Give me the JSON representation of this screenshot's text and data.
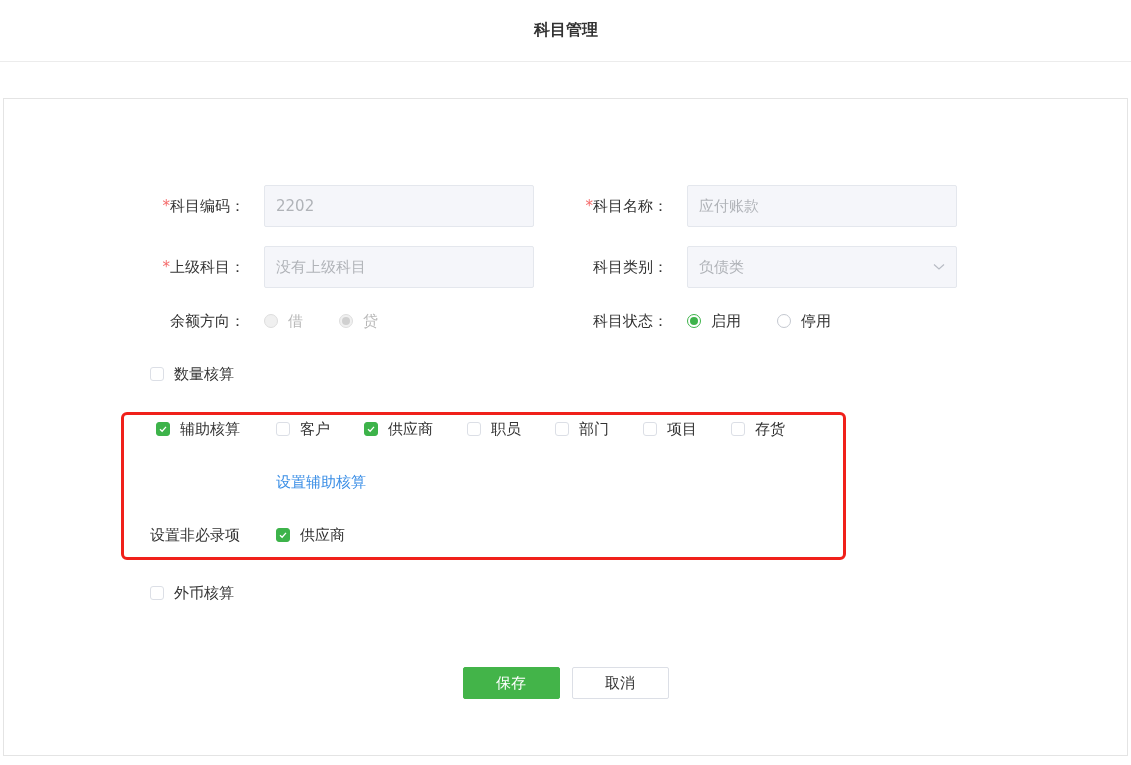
{
  "header": {
    "title": "科目管理"
  },
  "fields": [
    {
      "label": "科目编码：",
      "required_mark": "*",
      "kind": "input",
      "value": "2202"
    },
    {
      "label": "科目名称：",
      "required_mark": "*",
      "kind": "input",
      "value": "应付账款"
    },
    {
      "label": "上级科目：",
      "required_mark": "*",
      "kind": "input",
      "placeholder": "没有上级科目"
    },
    {
      "label": "科目类别：",
      "kind": "select",
      "value": "负债类"
    },
    {
      "label": "余额方向：",
      "kind": "radio",
      "disabled": true,
      "options": [
        {
          "label": "借",
          "selected": false
        },
        {
          "label": "贷",
          "selected": true
        }
      ]
    },
    {
      "label": "科目状态：",
      "kind": "radio",
      "disabled": false,
      "options": [
        {
          "label": "启用",
          "selected": true
        },
        {
          "label": "停用",
          "selected": false
        }
      ]
    }
  ],
  "quantity": {
    "label": "数量核算",
    "checked": false
  },
  "auxiliary": {
    "highlighted": true,
    "label": "辅助核算",
    "checked": true,
    "options": [
      {
        "label": "客户",
        "checked": false
      },
      {
        "label": "供应商",
        "checked": true
      },
      {
        "label": "职员",
        "checked": false
      },
      {
        "label": "部门",
        "checked": false
      },
      {
        "label": "项目",
        "checked": false
      },
      {
        "label": "存货",
        "checked": false
      }
    ],
    "link": "设置辅助核算",
    "optional_label": "设置非必录项",
    "optional_items": [
      {
        "label": "供应商",
        "checked": true
      }
    ]
  },
  "foreign_currency": {
    "label": "外币核算",
    "checked": false
  },
  "buttons": [
    {
      "label": "保存",
      "kind": "primary"
    },
    {
      "label": "取消",
      "kind": "default"
    }
  ]
}
